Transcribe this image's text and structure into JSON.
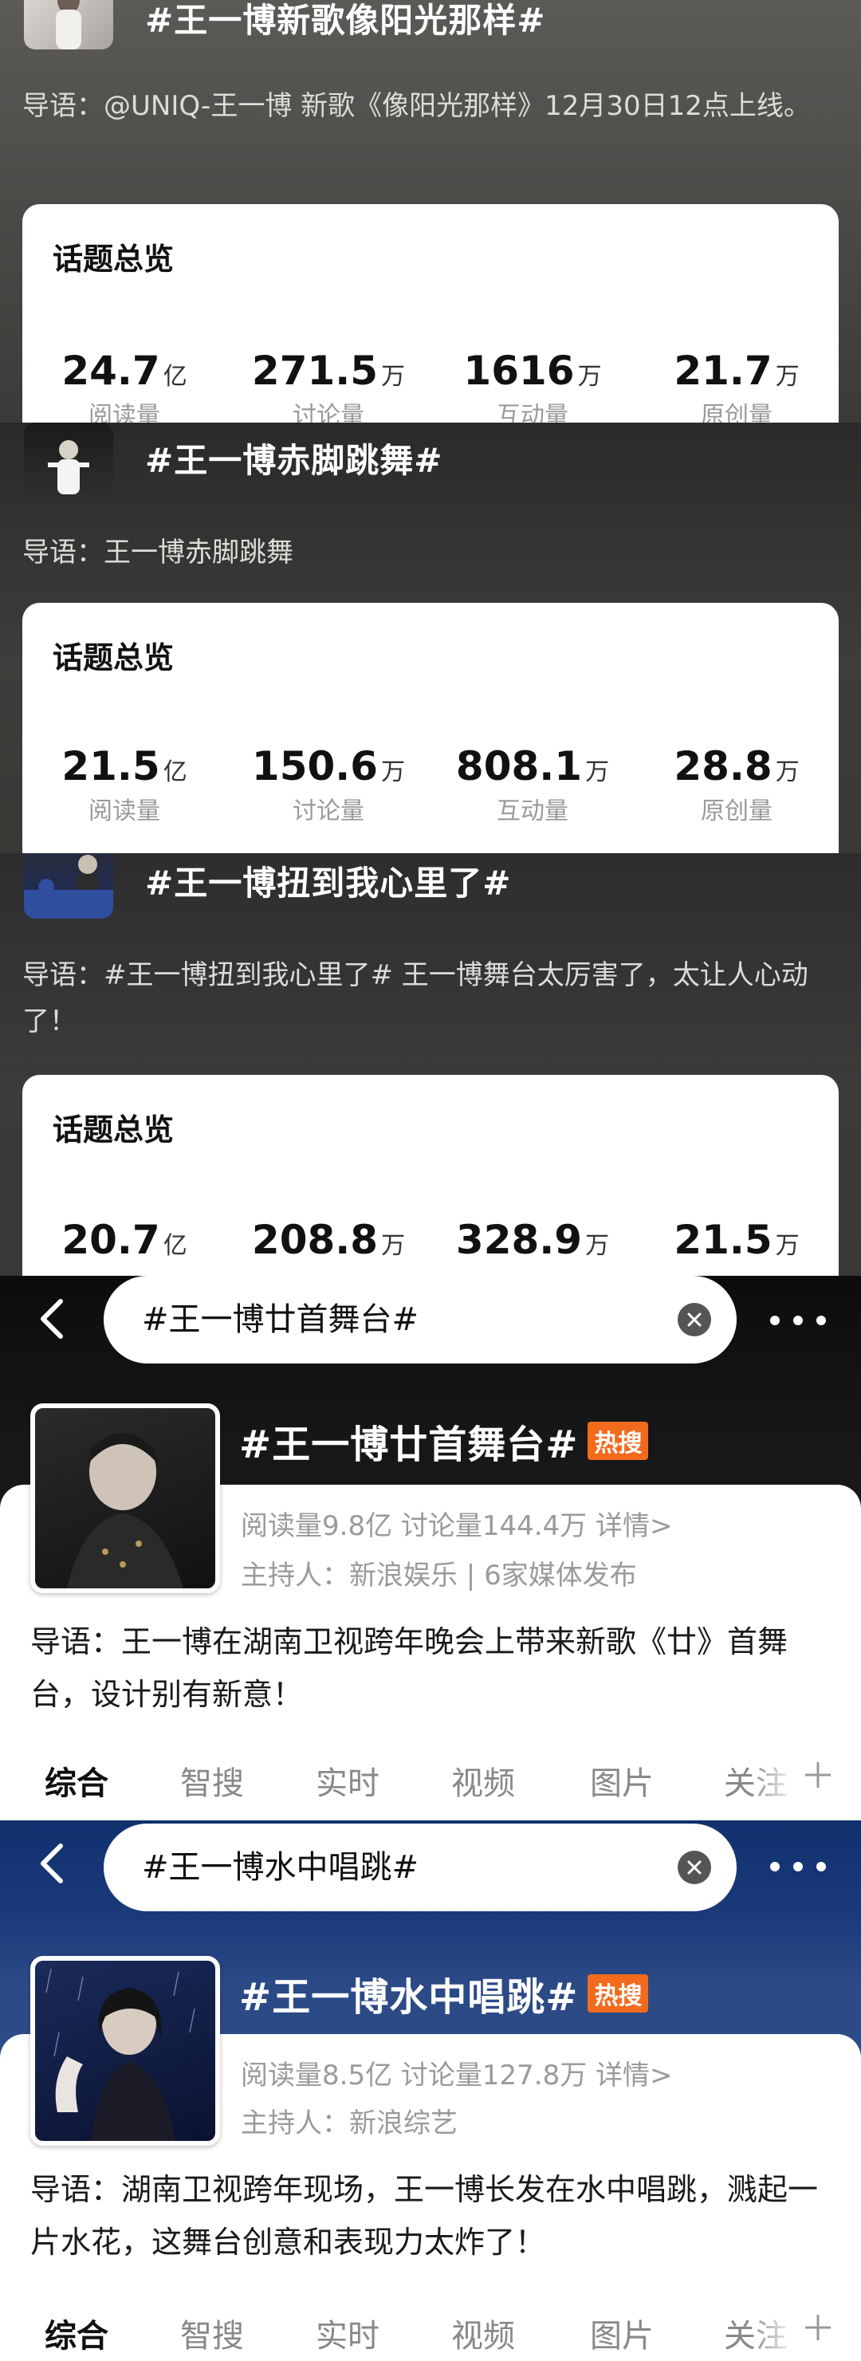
{
  "topics": [
    {
      "title": "#王一博新歌像阳光那样#",
      "intro": "导语：@UNIQ-王一博 新歌《像阳光那样》12月30日12点上线。",
      "overview_title": "话题总览",
      "stats": [
        {
          "num": "24.7",
          "unit": "亿",
          "label": "阅读量"
        },
        {
          "num": "271.5",
          "unit": "万",
          "label": "讨论量"
        },
        {
          "num": "1616",
          "unit": "万",
          "label": "互动量"
        },
        {
          "num": "21.7",
          "unit": "万",
          "label": "原创量"
        }
      ]
    },
    {
      "title": "#王一博赤脚跳舞#",
      "intro": "导语：王一博赤脚跳舞",
      "overview_title": "话题总览",
      "stats": [
        {
          "num": "21.5",
          "unit": "亿",
          "label": "阅读量"
        },
        {
          "num": "150.6",
          "unit": "万",
          "label": "讨论量"
        },
        {
          "num": "808.1",
          "unit": "万",
          "label": "互动量"
        },
        {
          "num": "28.8",
          "unit": "万",
          "label": "原创量"
        }
      ]
    },
    {
      "title": "#王一博扭到我心里了#",
      "intro": "导语：#王一博扭到我心里了# 王一博舞台太厉害了，太让人心动了！",
      "overview_title": "话题总览",
      "stats": [
        {
          "num": "20.7",
          "unit": "亿",
          "label": ""
        },
        {
          "num": "208.8",
          "unit": "万",
          "label": ""
        },
        {
          "num": "328.9",
          "unit": "万",
          "label": ""
        },
        {
          "num": "21.5",
          "unit": "万",
          "label": ""
        }
      ]
    }
  ],
  "results": [
    {
      "search_query": "#王一博廿首舞台#",
      "title": "#王一博廿首舞台#",
      "badge": "热搜",
      "meta": "阅读量9.8亿  讨论量144.4万  详情>",
      "host": "主持人：新浪娱乐 | 6家媒体发布",
      "intro": "导语：王一博在湖南卫视跨年晚会上带来新歌《廿》首舞台，设计别有新意！",
      "tabs": [
        "综合",
        "智搜",
        "实时",
        "视频",
        "图片",
        "关注"
      ]
    },
    {
      "search_query": "#王一博水中唱跳#",
      "title": "#王一博水中唱跳#",
      "badge": "热搜",
      "meta": "阅读量8.5亿  讨论量127.8万  详情>",
      "host": "主持人：新浪综艺",
      "intro": "导语：湖南卫视跨年现场，王一博长发在水中唱跳，溅起一片水花，这舞台创意和表现力太炸了！",
      "tabs": [
        "综合",
        "智搜",
        "实时",
        "视频",
        "图片",
        "关注"
      ]
    }
  ],
  "colors": {
    "hot_badge": "#f26b1d",
    "result2_bg": "#1a3a7a"
  }
}
